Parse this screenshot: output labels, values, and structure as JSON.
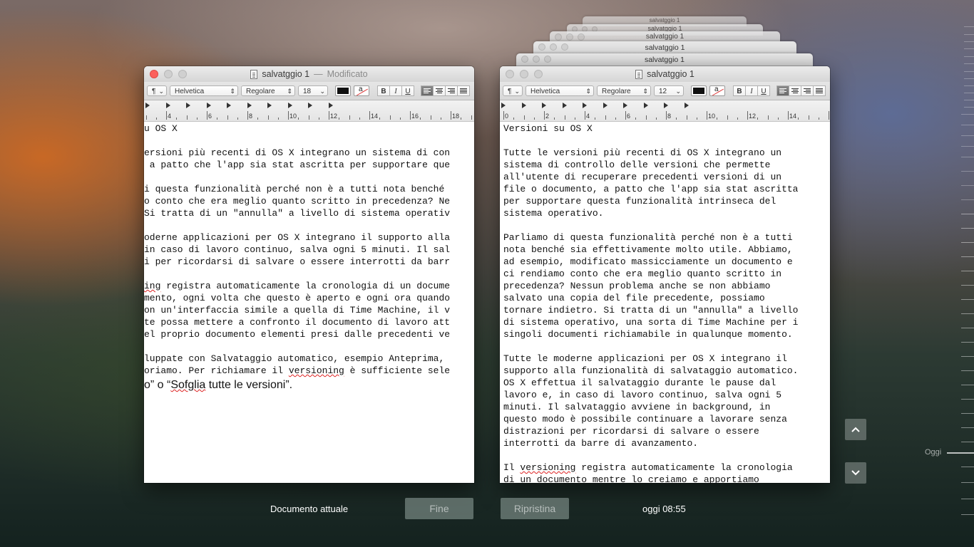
{
  "colors": {
    "close_red": "#fc605c",
    "active_align": "#6a6a6a",
    "button_bg": "#96a5a0"
  },
  "stack": {
    "titles": [
      "salvatggio 1",
      "salvatggio 1",
      "salvatggio 1",
      "salvatggio 1",
      "salvatggio 1"
    ]
  },
  "left_window": {
    "title": "salvatggio 1",
    "separator": "—",
    "status": "Modificato",
    "toolbar": {
      "paragraph": "¶",
      "font": "Helvetica",
      "style": "Regolare",
      "size": "18",
      "bold": "B",
      "italic": "I",
      "underline": "U"
    },
    "ruler_labels": [
      "4",
      "6",
      "8",
      "10",
      "12",
      "14",
      "16",
      "18"
    ],
    "lines": [
      "u OS X",
      "",
      "ersioni più recenti di OS X integrano un sistema di con",
      " a patto che l'app sia stat ascritta per supportare que",
      "",
      "i questa funzionalità perché non è a tutti nota benché",
      "o conto che era meglio quanto scritto in precedenza? Ne",
      "Si tratta di un \"annulla\" a livello di sistema operativ",
      "",
      "oderne applicazioni per OS X integrano il supporto alla",
      "in caso di lavoro continuo, salva ogni 5 minuti. Il sal",
      "i per ricordarsi di salvare o essere interrotti da barr",
      "",
      "ing registra automaticamente la cronologia di un docume",
      "mento, ogni volta che questo è aperto e ogni ora quando",
      "on un'interfaccia simile a quella di Time Machine, il v",
      "te possa mettere a confronto il documento di lavoro att",
      "el proprio documento elementi presi dalle precedenti ve",
      "",
      "luppate con Salvataggio automatico, esempio Anteprima,",
      "oriamo. Per richiamare il versioning è sufficiente sele"
    ],
    "last_line": "o” o “Sofglia tutte le versioni”."
  },
  "right_window": {
    "title": "salvatggio 1",
    "toolbar": {
      "paragraph": "¶",
      "font": "Helvetica",
      "style": "Regolare",
      "size": "12",
      "bold": "B",
      "italic": "I",
      "underline": "U"
    },
    "ruler_labels": [
      "0",
      "2",
      "4",
      "6",
      "8",
      "10",
      "12",
      "14"
    ],
    "lines": [
      "Versioni su OS X",
      "",
      "Tutte le versioni più recenti di OS X integrano un",
      "sistema di controllo delle versioni che permette",
      "all'utente di recuperare precedenti versioni di un",
      "file o documento, a patto che l'app sia stat ascritta",
      "per supportare questa funzionalità intrinseca del",
      "sistema operativo.",
      "",
      "Parliamo di questa funzionalità perché non è a tutti",
      "nota benché sia effettivamente molto utile. Abbiamo,",
      "ad esempio, modificato massicciamente un documento e",
      "ci rendiamo conto che era meglio quanto scritto in",
      "precedenza? Nessun problema anche se non abbiamo",
      "salvato una copia del file precedente, possiamo",
      "tornare indietro. Si tratta di un \"annulla\" a livello",
      "di sistema operativo, una sorta di Time Machine per i",
      "singoli documenti richiamabile in qualunque momento.",
      "",
      "Tutte le moderne applicazioni per OS X integrano il",
      "supporto alla funzionalità di salvataggio automatico.",
      "OS X effettua il salvataggio durante le pause dal",
      "lavoro e, in caso di lavoro continuo, salva ogni 5",
      "minuti. Il salvataggio avviene in background, in",
      "questo modo è possibile continuare a lavorare senza",
      "distrazioni per ricordarsi di salvare o essere",
      "interrotti da barre di avanzamento.",
      "",
      "Il versioning registra automaticamente la cronologia",
      "di un documento mentre lo creiamo e apportiamo"
    ]
  },
  "bottom": {
    "current_label": "Documento attuale",
    "done_button": "Fine",
    "restore_button": "Ripristina",
    "version_time": "oggi 08:55"
  },
  "timeline": {
    "today_label": "Oggi"
  }
}
